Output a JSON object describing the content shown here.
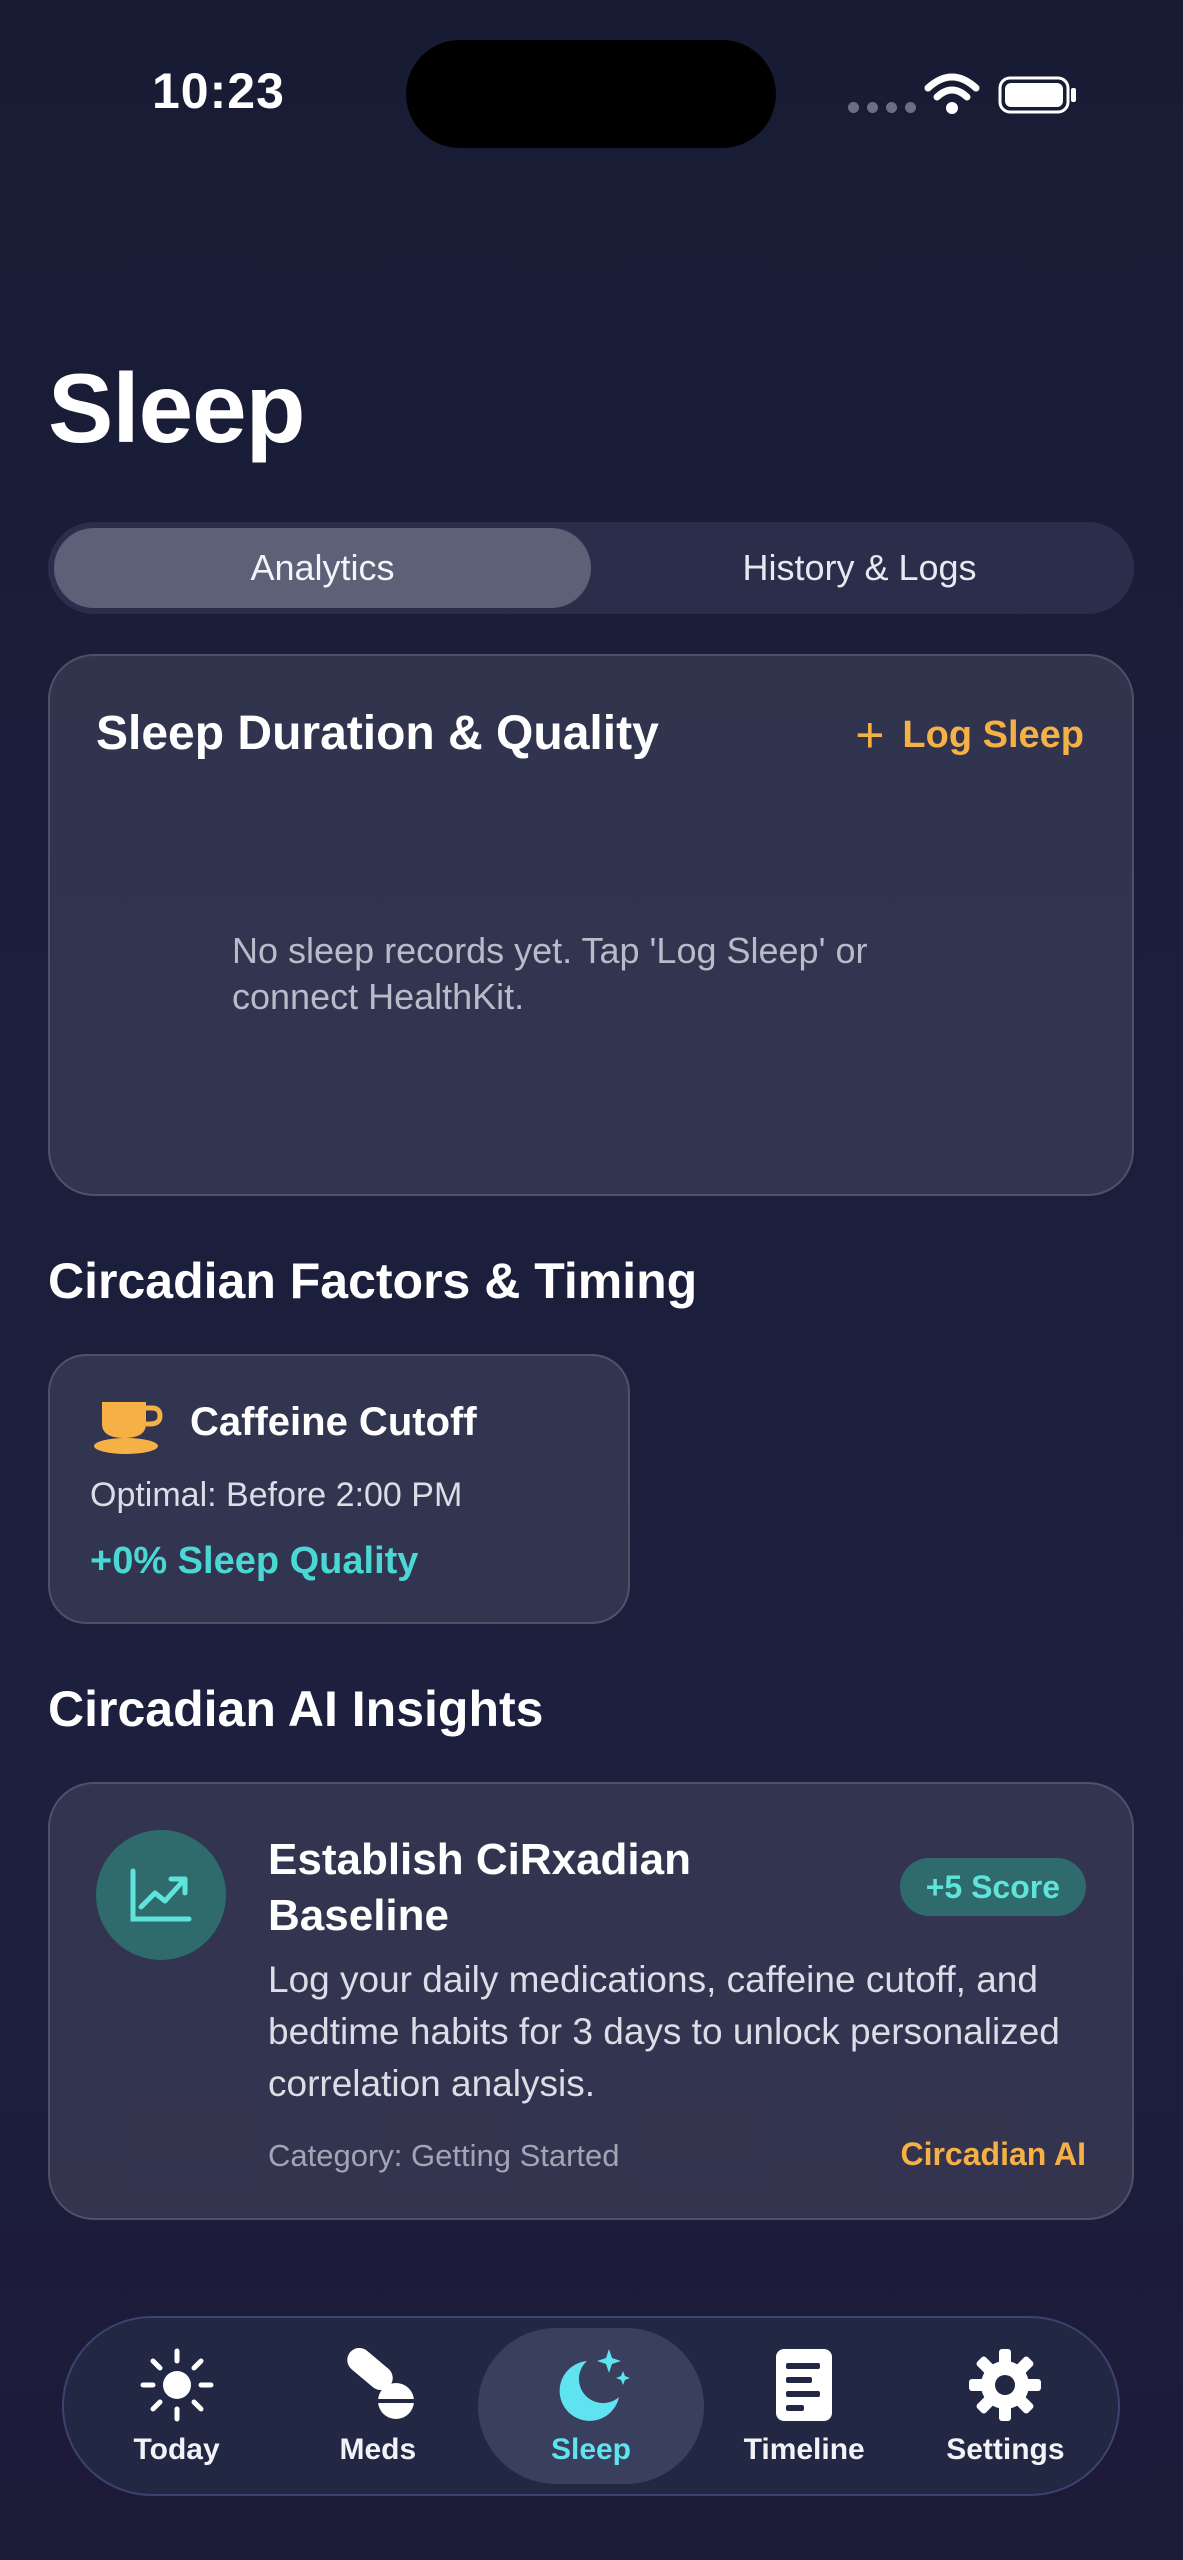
{
  "status_bar": {
    "time": "10:23"
  },
  "page_title": "Sleep",
  "segmented": {
    "tabs": [
      "Analytics",
      "History & Logs"
    ],
    "selected": "Analytics"
  },
  "sleep_card": {
    "title": "Sleep Duration & Quality",
    "action_label": "Log Sleep",
    "empty_message": "No sleep records yet. Tap 'Log Sleep' or connect HealthKit."
  },
  "circadian_factors": {
    "section_title": "Circadian Factors & Timing",
    "card": {
      "icon": "coffee-cup-icon",
      "title": "Caffeine Cutoff",
      "subtitle": "Optimal: Before 2:00 PM",
      "quality": "+0% Sleep Quality"
    }
  },
  "insights": {
    "section_title": "Circadian AI Insights",
    "card": {
      "icon": "trend-chart-icon",
      "title": "Establish CiRxadian Baseline",
      "badge": "+5 Score",
      "body": "Log your daily medications, caffeine cutoff, and bedtime habits for 3 days to unlock personalized correlation analysis.",
      "category": "Category: Getting Started",
      "source": "Circadian AI"
    }
  },
  "tabbar": {
    "items": [
      {
        "label": "Today",
        "icon": "sun-icon"
      },
      {
        "label": "Meds",
        "icon": "pills-icon"
      },
      {
        "label": "Sleep",
        "icon": "moon-stars-icon"
      },
      {
        "label": "Timeline",
        "icon": "document-icon"
      },
      {
        "label": "Settings",
        "icon": "gear-icon"
      }
    ],
    "selected": "Sleep"
  },
  "colors": {
    "accent_orange": "#f6b146",
    "accent_teal": "#49d8d4",
    "active_tab": "#5fe3f0",
    "background": "#1b1f3c"
  }
}
